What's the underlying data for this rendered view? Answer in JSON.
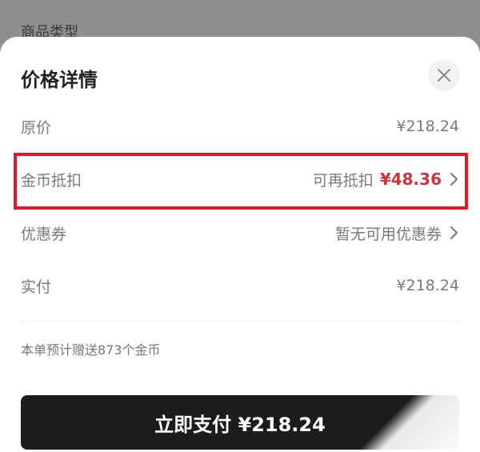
{
  "background": {
    "behind_label": "商品类型"
  },
  "sheet": {
    "title": "价格详情",
    "close_icon": "close-icon"
  },
  "rows": {
    "original_price": {
      "label": "原价",
      "value": "¥218.24"
    },
    "coin_deduction": {
      "label": "金币抵扣",
      "prefix": "可再抵扣",
      "amount": "¥48.36",
      "icon": "chevron-right-icon"
    },
    "coupon": {
      "label": "优惠券",
      "value": "暂无可用优惠券",
      "icon": "chevron-right-icon"
    },
    "actual_paid": {
      "label": "实付",
      "value": "¥218.24"
    }
  },
  "note": "本单预计赠送873个金币",
  "pay_button": {
    "label": "立即支付 ¥218.24"
  },
  "colors": {
    "accent_red": "#c9363b",
    "highlight_border": "#e11a2a",
    "pay_bg": "#1c1c1c"
  }
}
